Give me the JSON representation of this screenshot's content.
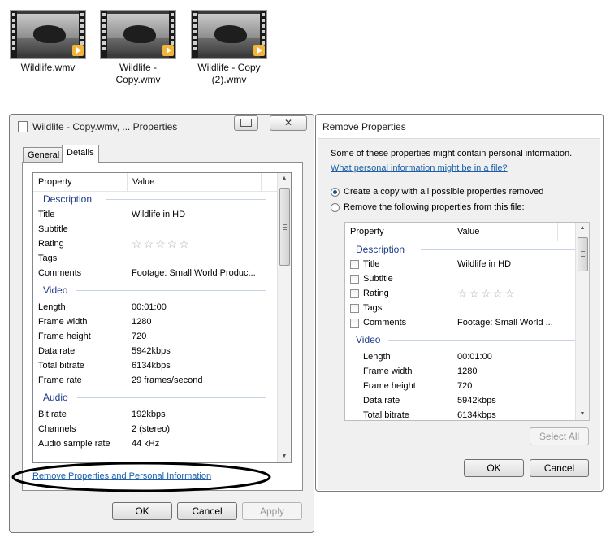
{
  "files": [
    {
      "name": "Wildlife.wmv"
    },
    {
      "name": "Wildlife -\nCopy.wmv"
    },
    {
      "name": "Wildlife - Copy\n(2).wmv"
    }
  ],
  "props_dialog": {
    "title": "Wildlife - Copy.wmv, ... Properties",
    "close_glyph": "✕",
    "tabs": [
      "General",
      "Details"
    ],
    "active_tab": "Details",
    "columns": [
      "Property",
      "Value"
    ],
    "groups": [
      {
        "label": "Description",
        "rows": [
          {
            "property": "Title",
            "value": "Wildlife in HD"
          },
          {
            "property": "Subtitle",
            "value": ""
          },
          {
            "property": "Rating",
            "value": "☆☆☆☆☆"
          },
          {
            "property": "Tags",
            "value": ""
          },
          {
            "property": "Comments",
            "value": "Footage: Small World Produc..."
          }
        ]
      },
      {
        "label": "Video",
        "rows": [
          {
            "property": "Length",
            "value": "00:01:00"
          },
          {
            "property": "Frame width",
            "value": "1280"
          },
          {
            "property": "Frame height",
            "value": "720"
          },
          {
            "property": "Data rate",
            "value": "5942kbps"
          },
          {
            "property": "Total bitrate",
            "value": "6134kbps"
          },
          {
            "property": "Frame rate",
            "value": "29 frames/second"
          }
        ]
      },
      {
        "label": "Audio",
        "rows": [
          {
            "property": "Bit rate",
            "value": "192kbps"
          },
          {
            "property": "Channels",
            "value": "2 (stereo)"
          },
          {
            "property": "Audio sample rate",
            "value": "44 kHz"
          }
        ]
      }
    ],
    "remove_link": "Remove Properties and Personal Information",
    "buttons": {
      "ok": "OK",
      "cancel": "Cancel",
      "apply": "Apply"
    }
  },
  "remove_dialog": {
    "title": "Remove Properties",
    "intro": "Some of these properties might contain personal information.",
    "info_link": "What personal information might be in a file?",
    "option_copy": "Create a copy with all possible properties removed",
    "option_remove": "Remove the following properties from this file:",
    "selected_option": "copy",
    "columns": [
      "Property",
      "Value"
    ],
    "groups": [
      {
        "label": "Description",
        "rows": [
          {
            "property": "Title",
            "value": "Wildlife in HD",
            "checkbox": true
          },
          {
            "property": "Subtitle",
            "value": "",
            "checkbox": true
          },
          {
            "property": "Rating",
            "value": "☆☆☆☆☆",
            "checkbox": true
          },
          {
            "property": "Tags",
            "value": "",
            "checkbox": true
          },
          {
            "property": "Comments",
            "value": "Footage: Small World ...",
            "checkbox": true
          }
        ]
      },
      {
        "label": "Video",
        "rows": [
          {
            "property": "Length",
            "value": "00:01:00"
          },
          {
            "property": "Frame width",
            "value": "1280"
          },
          {
            "property": "Frame height",
            "value": "720"
          },
          {
            "property": "Data rate",
            "value": "5942kbps"
          },
          {
            "property": "Total bitrate",
            "value": "6134kbps"
          }
        ]
      }
    ],
    "buttons": {
      "select_all": "Select All",
      "ok": "OK",
      "cancel": "Cancel"
    }
  },
  "colors": {
    "link": "#1a5fa8",
    "group_header": "#1e3a8a",
    "annotation_ellipse": "#000000"
  }
}
